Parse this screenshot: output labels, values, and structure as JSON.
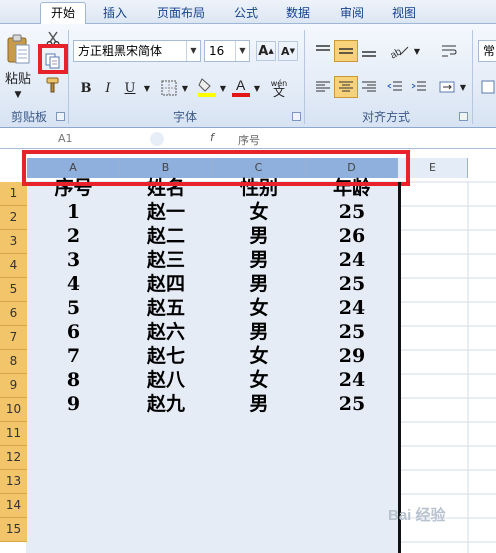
{
  "ribbon_tabs": [
    "开始",
    "插入",
    "页面布局",
    "公式",
    "数据",
    "审阅",
    "视图"
  ],
  "clipboard": {
    "paste_label": "粘贴",
    "group_label": "剪贴板"
  },
  "font": {
    "name": "方正粗黑宋简体",
    "size": "16",
    "group_label": "字体",
    "bold": "B",
    "italic": "I",
    "underline": "U",
    "grow": "A",
    "shrink": "A",
    "phonetic": "wén"
  },
  "alignment": {
    "group_label": "对齐方式"
  },
  "cut_off_text": "常",
  "formula_bar": {
    "cell_ref": "A1",
    "content": "序号"
  },
  "columns": [
    "A",
    "B",
    "C",
    "D",
    "E"
  ],
  "rows": [
    "1",
    "2",
    "3",
    "4",
    "5",
    "6",
    "7",
    "8",
    "9",
    "10",
    "11",
    "12",
    "13",
    "14",
    "15"
  ],
  "headers": [
    "序号",
    "姓名",
    "性别",
    "年龄"
  ],
  "table": [
    [
      "1",
      "赵一",
      "女",
      "25"
    ],
    [
      "2",
      "赵二",
      "男",
      "26"
    ],
    [
      "3",
      "赵三",
      "男",
      "24"
    ],
    [
      "4",
      "赵四",
      "男",
      "25"
    ],
    [
      "5",
      "赵五",
      "女",
      "24"
    ],
    [
      "6",
      "赵六",
      "男",
      "25"
    ],
    [
      "7",
      "赵七",
      "女",
      "29"
    ],
    [
      "8",
      "赵八",
      "女",
      "24"
    ],
    [
      "9",
      "赵九",
      "男",
      "25"
    ]
  ],
  "watermark": "Bai 经验",
  "colors": {
    "highlight": "#e8222a",
    "row_header": "#f3c56a",
    "selection": "#e6ecf6",
    "accent": "#15428b"
  }
}
